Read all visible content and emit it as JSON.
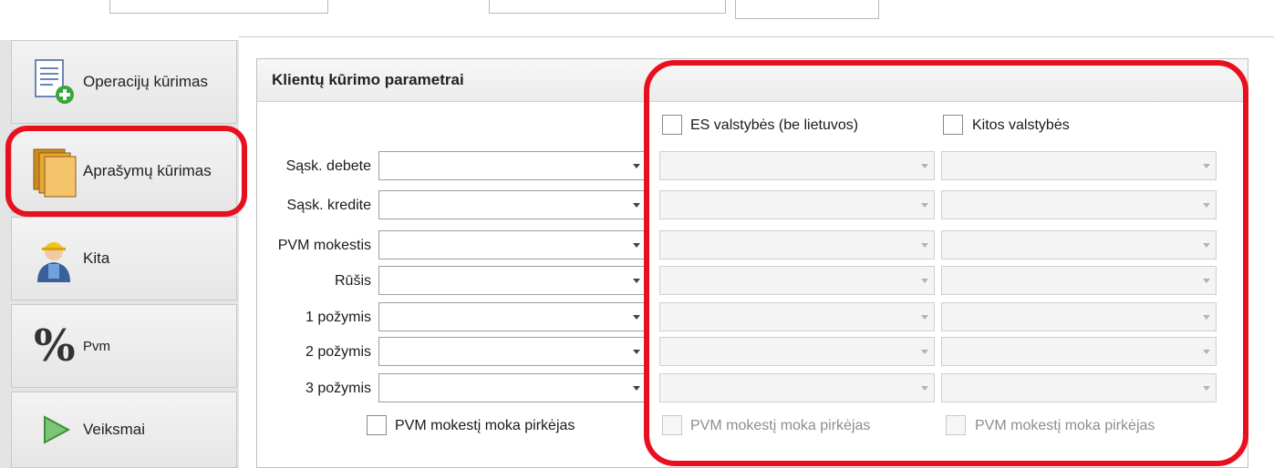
{
  "sidebar": {
    "items": [
      {
        "label": "Operacijų kūrimas",
        "icon": "document-add-icon"
      },
      {
        "label": "Aprašymų kūrimas",
        "icon": "folders-icon"
      },
      {
        "label": "Kita",
        "icon": "worker-icon"
      },
      {
        "label": "Pvm",
        "icon": "percent-icon"
      },
      {
        "label": "Veiksmai",
        "icon": "play-icon"
      }
    ]
  },
  "panel": {
    "title": "Klientų kūrimo parametrai",
    "columns": {
      "es_label": "ES valstybės (be lietuvos)",
      "other_label": "Kitos valstybės"
    },
    "rows": [
      "Sąsk. debete",
      "Sąsk. kredite",
      "PVM mokestis",
      "Rūšis",
      "1 požymis",
      "2 požymis",
      "3 požymis"
    ],
    "buyer_pays_label": "PVM mokestį moka pirkėjas",
    "percent_glyph": "%"
  },
  "colors": {
    "highlight": "#e8101e",
    "sidebar_bg": "#e4e4e4"
  }
}
